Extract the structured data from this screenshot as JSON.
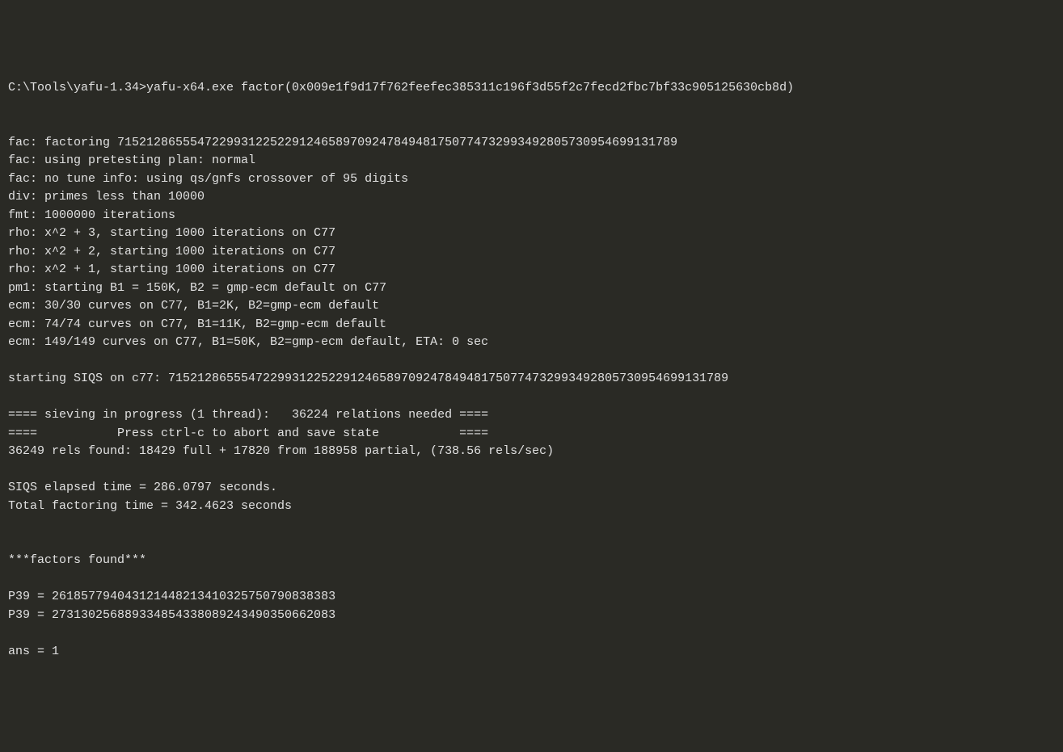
{
  "terminal": {
    "prompt_path": "C:\\Tools\\yafu-1.34>",
    "command": "yafu-x64.exe factor(0x009e1f9d17f762feefec385311c196f3d55f2c7fecd2fbc7bf33c905125630cb8d)",
    "blank1": "",
    "blank2": "",
    "line_fac_number": "fac: factoring 71521286555472299312252291246589709247849481750774732993492805730954699131789",
    "line_fac_plan": "fac: using pretesting plan: normal",
    "line_fac_tune": "fac: no tune info: using qs/gnfs crossover of 95 digits",
    "line_div": "div: primes less than 10000",
    "line_fmt": "fmt: 1000000 iterations",
    "line_rho1": "rho: x^2 + 3, starting 1000 iterations on C77",
    "line_rho2": "rho: x^2 + 2, starting 1000 iterations on C77",
    "line_rho3": "rho: x^2 + 1, starting 1000 iterations on C77",
    "line_pm1": "pm1: starting B1 = 150K, B2 = gmp-ecm default on C77",
    "line_ecm1": "ecm: 30/30 curves on C77, B1=2K, B2=gmp-ecm default",
    "line_ecm2": "ecm: 74/74 curves on C77, B1=11K, B2=gmp-ecm default",
    "line_ecm3": "ecm: 149/149 curves on C77, B1=50K, B2=gmp-ecm default, ETA: 0 sec",
    "blank3": "",
    "line_siqs_start": "starting SIQS on c77: 71521286555472299312252291246589709247849481750774732993492805730954699131789",
    "blank4": "",
    "line_sieve1": "==== sieving in progress (1 thread):   36224 relations needed ====",
    "line_sieve2": "====           Press ctrl-c to abort and save state           ====",
    "line_rels": "36249 rels found: 18429 full + 17820 from 188958 partial, (738.56 rels/sec)",
    "blank5": "",
    "line_siqs_time": "SIQS elapsed time = 286.0797 seconds.",
    "line_total_time": "Total factoring time = 342.4623 seconds",
    "blank6": "",
    "blank7": "",
    "line_factors_header": "***factors found***",
    "blank8": "",
    "line_p39_1": "P39 = 261857794043121448213410325750790838383",
    "line_p39_2": "P39 = 273130256889334854338089243490350662083",
    "blank9": "",
    "line_ans": "ans = 1"
  }
}
